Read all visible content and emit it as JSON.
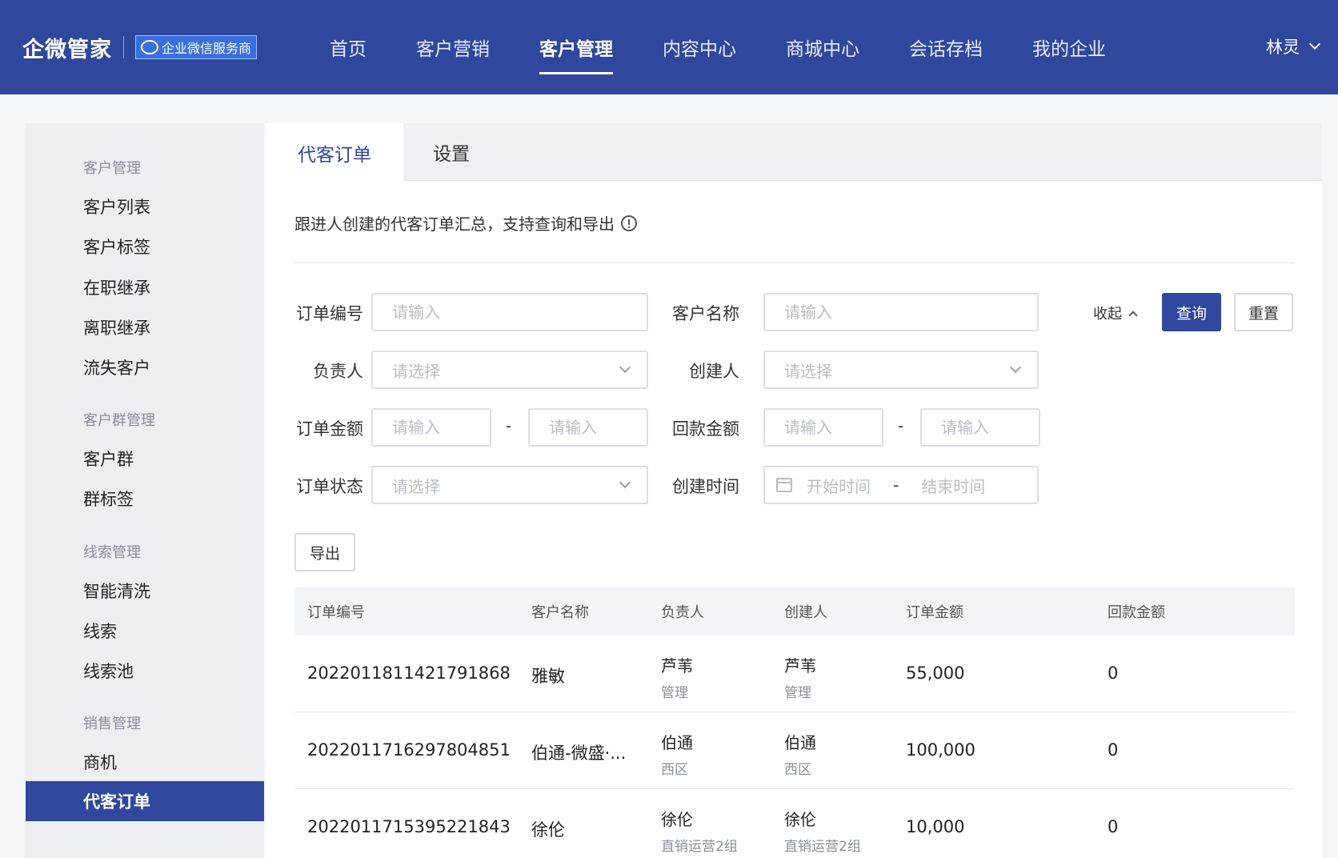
{
  "header": {
    "brand": "企微管家",
    "badge": "企业微信服务商",
    "nav": [
      "首页",
      "客户营销",
      "客户管理",
      "内容中心",
      "商城中心",
      "会话存档",
      "我的企业"
    ],
    "user": "林灵"
  },
  "sidebar": {
    "groups": [
      {
        "title": "客户管理",
        "items": [
          "客户列表",
          "客户标签",
          "在职继承",
          "离职继承",
          "流失客户"
        ]
      },
      {
        "title": "客户群管理",
        "items": [
          "客户群",
          "群标签"
        ]
      },
      {
        "title": "线索管理",
        "items": [
          "智能清洗",
          "线索",
          "线索池"
        ]
      },
      {
        "title": "销售管理",
        "items": [
          "商机",
          "代客订单"
        ]
      }
    ]
  },
  "tabs": [
    "代客订单",
    "设置"
  ],
  "description": "跟进人创建的代客订单汇总，支持查询和导出",
  "filters": {
    "order_no": {
      "label": "订单编号",
      "placeholder": "请输入"
    },
    "customer": {
      "label": "客户名称",
      "placeholder": "请输入"
    },
    "owner": {
      "label": "负责人",
      "placeholder": "请选择"
    },
    "creator": {
      "label": "创建人",
      "placeholder": "请选择"
    },
    "amount": {
      "label": "订单金额",
      "placeholder_min": "请输入",
      "placeholder_max": "请输入"
    },
    "payback": {
      "label": "回款金额",
      "placeholder_min": "请输入",
      "placeholder_max": "请输入"
    },
    "status": {
      "label": "订单状态",
      "placeholder": "请选择"
    },
    "created": {
      "label": "创建时间",
      "start": "开始时间",
      "end": "结束时间"
    },
    "range_sep": "-"
  },
  "actions": {
    "collapse": "收起",
    "query": "查询",
    "reset": "重置",
    "export": "导出"
  },
  "table": {
    "columns": [
      "订单编号",
      "客户名称",
      "负责人",
      "创建人",
      "订单金额",
      "回款金额"
    ],
    "rows": [
      {
        "order_no": "202201181142179186​8",
        "customer": "雅敏",
        "owner": "芦苇",
        "owner_dept": "管理",
        "creator": "芦苇",
        "creator_dept": "管理",
        "amount": "55,000",
        "payback": "0"
      },
      {
        "order_no": "2022011716297804851",
        "customer": "伯通-微盛·...",
        "owner": "伯通",
        "owner_dept": "西区",
        "creator": "伯通",
        "creator_dept": "西区",
        "amount": "100,000",
        "payback": "0"
      },
      {
        "order_no": "2022011715395221843",
        "customer": "徐伦",
        "owner": "徐伦",
        "owner_dept": "直销运营2组",
        "creator": "徐伦",
        "creator_dept": "直销运营2组",
        "amount": "10,000",
        "payback": "0"
      }
    ]
  }
}
